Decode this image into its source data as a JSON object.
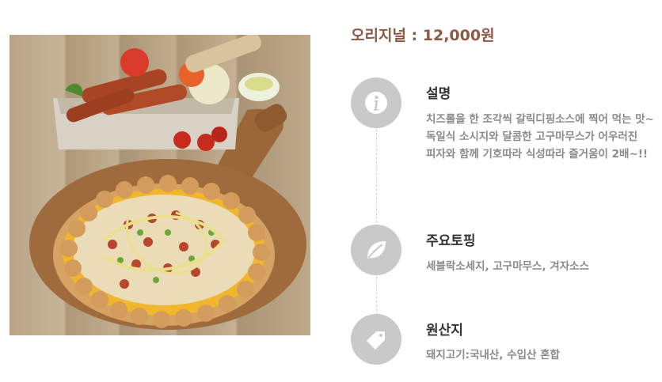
{
  "price": "오리지널 : 12,000원",
  "sections": [
    {
      "icon": "info-icon",
      "title": "설명",
      "body": "치즈롤을 한 조각씩 갈릭디핑소스에 찍어 먹는 맛~ 독일식 소시지와 달콤한 고구마무스가 어우러진 피자와 함께 기호따라 식성따라 즐거움이 2배~!!"
    },
    {
      "icon": "leaf-icon",
      "title": "주요토핑",
      "body": "세블락소세지, 고구마무스, 겨자소스"
    },
    {
      "icon": "tag-icon",
      "title": "원산지",
      "body": "돼지고기:국내산, 수입산 혼합"
    }
  ]
}
